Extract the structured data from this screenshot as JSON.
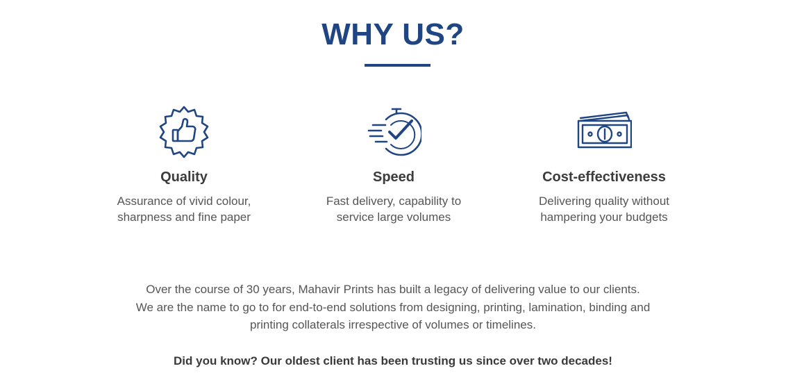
{
  "section": {
    "title": "WHY US?"
  },
  "colors": {
    "brand_blue": "#1f4583",
    "text_dark": "#3c3c3c",
    "text_body": "#555555"
  },
  "features": [
    {
      "icon": "thumbs-up-badge-icon",
      "title": "Quality",
      "desc_lines": [
        "Assurance of vivid colour,",
        "sharpness and fine paper"
      ]
    },
    {
      "icon": "stopwatch-check-icon",
      "title": "Speed",
      "desc_lines": [
        "Fast delivery, capability to",
        "service large volumes"
      ]
    },
    {
      "icon": "banknotes-icon",
      "title": "Cost-effectiveness",
      "desc_lines": [
        "Delivering quality without",
        "hampering your budgets"
      ]
    }
  ],
  "about": {
    "lines": [
      "Over the course of 30 years, Mahavir Prints has built a legacy of delivering value to our clients.",
      "We are the name to go to for end-to-end solutions from designing, printing, lamination, binding and",
      "printing collaterals irrespective of volumes or timelines."
    ],
    "highlight": "Did you know? Our oldest client has been trusting us since over two decades!"
  }
}
